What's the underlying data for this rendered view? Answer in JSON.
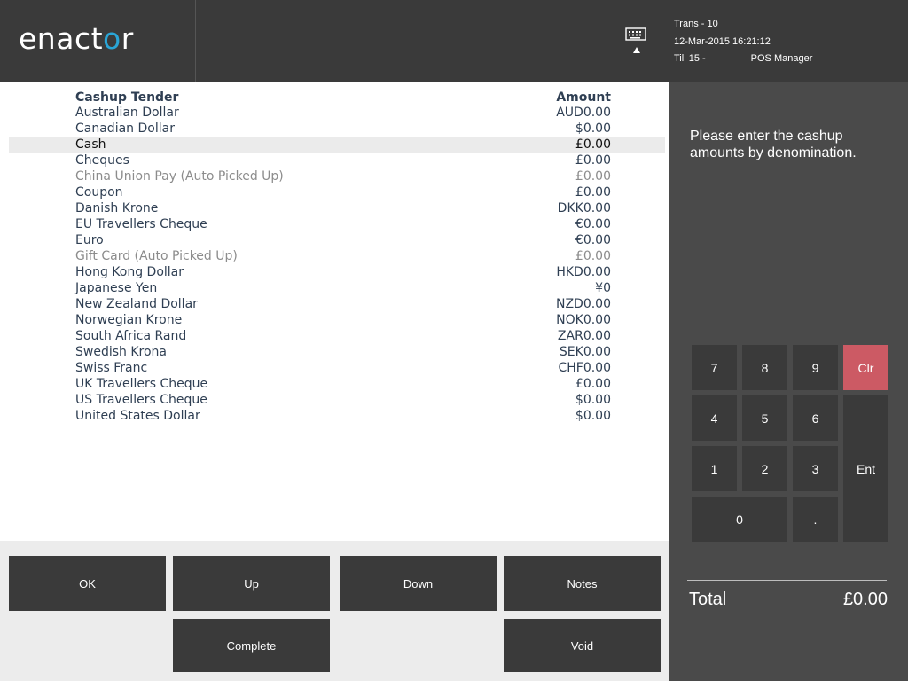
{
  "header": {
    "logo": {
      "text_before": "enact",
      "ring": "o",
      "text_after": "r"
    },
    "trans": "Trans - 10",
    "datetime": "12-Mar-2015 16:21:12",
    "till": "Till 15 -",
    "role": "POS Manager",
    "keyboard_icon": "keyboard-icon"
  },
  "list": {
    "header_tender": "Cashup Tender",
    "header_amount": "Amount",
    "rows": [
      {
        "name": "Australian Dollar",
        "amount": "AUD0.00"
      },
      {
        "name": "Canadian Dollar",
        "amount": "$0.00"
      },
      {
        "name": "Cash",
        "amount": "£0.00"
      },
      {
        "name": "Cheques",
        "amount": "£0.00"
      },
      {
        "name": "China Union Pay (Auto Picked Up)",
        "amount": "£0.00"
      },
      {
        "name": "Coupon",
        "amount": "£0.00"
      },
      {
        "name": "Danish Krone",
        "amount": "DKK0.00"
      },
      {
        "name": "EU Travellers Cheque",
        "amount": "€0.00"
      },
      {
        "name": "Euro",
        "amount": "€0.00"
      },
      {
        "name": "Gift Card (Auto Picked Up)",
        "amount": "£0.00"
      },
      {
        "name": "Hong Kong Dollar",
        "amount": "HKD0.00"
      },
      {
        "name": "Japanese Yen",
        "amount": "¥0"
      },
      {
        "name": "New Zealand Dollar",
        "amount": "NZD0.00"
      },
      {
        "name": "Norwegian Krone",
        "amount": "NOK0.00"
      },
      {
        "name": "South Africa Rand",
        "amount": "ZAR0.00"
      },
      {
        "name": "Swedish Krona",
        "amount": "SEK0.00"
      },
      {
        "name": "Swiss Franc",
        "amount": "CHF0.00"
      },
      {
        "name": "UK Travellers Cheque",
        "amount": "£0.00"
      },
      {
        "name": "US Travellers Cheque",
        "amount": "$0.00"
      },
      {
        "name": "United States Dollar",
        "amount": "$0.00"
      }
    ]
  },
  "buttons": {
    "ok": "OK",
    "up": "Up",
    "down": "Down",
    "notes": "Notes",
    "complete": "Complete",
    "void": "Void"
  },
  "prompt": "Please enter the cashup amounts by denomination.",
  "keypad": {
    "k7": "7",
    "k8": "8",
    "k9": "9",
    "clr": "Clr",
    "k4": "4",
    "k5": "5",
    "k6": "6",
    "k1": "1",
    "k2": "2",
    "k3": "3",
    "ent": "Ent",
    "k0": "0",
    "dot": "."
  },
  "total": {
    "label": "Total",
    "value": "£0.00"
  },
  "colors": {
    "header_bg": "#3a3a3a",
    "logo_accent": "#2aa5d6",
    "list_text": "#2f3f53",
    "clear_key": "#cc5a64",
    "right_panel_bg": "#4a4a4a"
  }
}
